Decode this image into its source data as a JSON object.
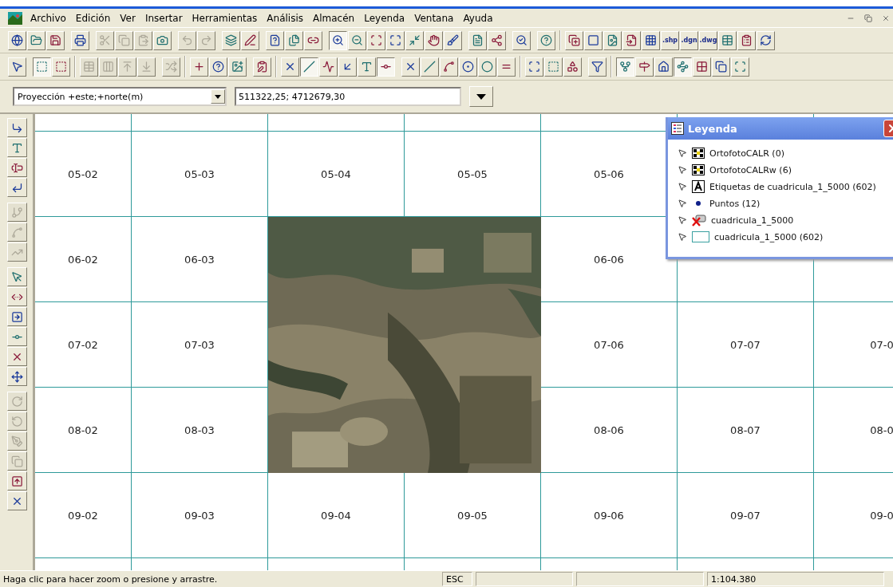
{
  "menu": [
    "Archivo",
    "Edición",
    "Ver",
    "Insertar",
    "Herramientas",
    "Análisis",
    "Almacén",
    "Leyenda",
    "Ventana",
    "Ayuda"
  ],
  "toolbar_1": [
    {
      "disabled": false,
      "pressed": false
    },
    {
      "disabled": false,
      "pressed": false
    },
    {
      "disabled": false,
      "pressed": false
    },
    {
      "kind": "sep"
    },
    {
      "disabled": false,
      "pressed": false
    },
    {
      "kind": "sep"
    },
    {
      "disabled": true,
      "pressed": false
    },
    {
      "disabled": true,
      "pressed": false
    },
    {
      "disabled": true,
      "pressed": false
    },
    {
      "disabled": false,
      "pressed": false
    },
    {
      "kind": "sep"
    },
    {
      "disabled": true,
      "pressed": false
    },
    {
      "disabled": true,
      "pressed": false
    },
    {
      "kind": "sep"
    },
    {
      "disabled": false,
      "pressed": false
    },
    {
      "disabled": false,
      "pressed": false
    },
    {
      "kind": "sep"
    },
    {
      "disabled": false,
      "pressed": false
    },
    {
      "disabled": false,
      "pressed": false
    },
    {
      "disabled": false,
      "pressed": false
    },
    {
      "kind": "sep"
    },
    {
      "disabled": false,
      "pressed": true
    },
    {
      "disabled": false,
      "pressed": false
    },
    {
      "disabled": false,
      "pressed": false
    },
    {
      "disabled": false,
      "pressed": false
    },
    {
      "disabled": false,
      "pressed": false
    },
    {
      "disabled": false,
      "pressed": false
    },
    {
      "disabled": false,
      "pressed": false
    },
    {
      "kind": "sep"
    },
    {
      "disabled": false,
      "pressed": false
    },
    {
      "disabled": false,
      "pressed": false
    },
    {
      "kind": "sep"
    },
    {
      "disabled": false,
      "pressed": false
    },
    {
      "kind": "sep"
    },
    {
      "disabled": false,
      "pressed": false
    },
    {
      "kind": "bar"
    },
    {
      "disabled": false,
      "pressed": false
    },
    {
      "disabled": false,
      "pressed": false
    },
    {
      "disabled": false,
      "pressed": false
    },
    {
      "disabled": false,
      "pressed": false
    },
    {
      "disabled": false,
      "pressed": false
    },
    {
      "disabled": false,
      "pressed": false,
      "label": ".shp"
    },
    {
      "disabled": false,
      "pressed": false,
      "label": ".dgn"
    },
    {
      "disabled": false,
      "pressed": false,
      "label": ".dwg"
    },
    {
      "disabled": false,
      "pressed": false
    },
    {
      "disabled": false,
      "pressed": false
    },
    {
      "disabled": false,
      "pressed": false
    }
  ],
  "toolbar_2": [
    {
      "disabled": false,
      "pressed": false
    },
    {
      "kind": "sep"
    },
    {
      "disabled": false,
      "pressed": true
    },
    {
      "disabled": false,
      "pressed": false
    },
    {
      "kind": "bar"
    },
    {
      "disabled": true,
      "pressed": false
    },
    {
      "disabled": true,
      "pressed": false
    },
    {
      "disabled": true,
      "pressed": false
    },
    {
      "disabled": true,
      "pressed": false
    },
    {
      "kind": "sep"
    },
    {
      "disabled": true,
      "pressed": false
    },
    {
      "kind": "bar"
    },
    {
      "disabled": false,
      "pressed": false
    },
    {
      "disabled": false,
      "pressed": false
    },
    {
      "disabled": false,
      "pressed": false
    },
    {
      "kind": "sep"
    },
    {
      "disabled": false,
      "pressed": false
    },
    {
      "kind": "bar"
    },
    {
      "disabled": false,
      "pressed": false
    },
    {
      "disabled": false,
      "pressed": true
    },
    {
      "disabled": false,
      "pressed": false
    },
    {
      "disabled": false,
      "pressed": false
    },
    {
      "disabled": false,
      "pressed": false
    },
    {
      "disabled": false,
      "pressed": true
    },
    {
      "kind": "sep"
    },
    {
      "disabled": false,
      "pressed": false
    },
    {
      "disabled": false,
      "pressed": false
    },
    {
      "disabled": false,
      "pressed": false
    },
    {
      "disabled": false,
      "pressed": false
    },
    {
      "disabled": false,
      "pressed": false
    },
    {
      "disabled": false,
      "pressed": false
    },
    {
      "kind": "bar"
    },
    {
      "disabled": false,
      "pressed": false
    },
    {
      "disabled": false,
      "pressed": false
    },
    {
      "disabled": false,
      "pressed": false
    },
    {
      "kind": "sep"
    },
    {
      "disabled": false,
      "pressed": false
    },
    {
      "kind": "bar"
    },
    {
      "disabled": false,
      "pressed": true
    },
    {
      "disabled": false,
      "pressed": false
    },
    {
      "disabled": false,
      "pressed": false
    },
    {
      "disabled": false,
      "pressed": true
    },
    {
      "disabled": false,
      "pressed": false
    },
    {
      "disabled": false,
      "pressed": false
    },
    {
      "disabled": false,
      "pressed": false
    }
  ],
  "coordinates": {
    "projection": "Proyección +este;+norte(m)",
    "value": "511322,25; 4712679,30"
  },
  "side_toolbar": [
    {
      "disabled": false
    },
    {
      "disabled": false
    },
    {
      "disabled": false
    },
    {
      "disabled": false
    },
    {
      "kind": "sep"
    },
    {
      "disabled": true
    },
    {
      "disabled": true
    },
    {
      "disabled": true
    },
    {
      "kind": "sep"
    },
    {
      "disabled": false
    },
    {
      "disabled": false
    },
    {
      "disabled": false
    },
    {
      "disabled": false
    },
    {
      "disabled": false
    },
    {
      "disabled": false
    },
    {
      "kind": "sep"
    },
    {
      "disabled": true
    },
    {
      "disabled": true
    },
    {
      "disabled": true
    },
    {
      "disabled": true
    },
    {
      "disabled": false
    },
    {
      "disabled": false
    }
  ],
  "map": {
    "rows": [
      [
        {
          "kind": "blank"
        },
        {
          "kind": "blank"
        },
        {
          "kind": "blank"
        },
        {
          "kind": "blank"
        },
        {
          "kind": "blank"
        },
        {
          "kind": "blank"
        },
        {
          "kind": "hidden"
        }
      ],
      [
        {
          "label": "05-02"
        },
        {
          "label": "05-03"
        },
        {
          "label": "05-04"
        },
        {
          "label": "05-05"
        },
        {
          "label": "05-06"
        },
        {
          "kind": "hidden"
        },
        {
          "kind": "hidden"
        }
      ],
      [
        {
          "label": "06-02"
        },
        {
          "label": "06-03"
        },
        {
          "kind": "covered"
        },
        {
          "kind": "covered"
        },
        {
          "label": "06-06"
        },
        {
          "kind": "blank"
        },
        {
          "kind": "blank"
        }
      ],
      [
        {
          "label": "07-02"
        },
        {
          "label": "07-03"
        },
        {
          "kind": "covered"
        },
        {
          "kind": "covered"
        },
        {
          "label": "07-06"
        },
        {
          "label": "07-07"
        },
        {
          "label": "07-0"
        }
      ],
      [
        {
          "label": "08-02"
        },
        {
          "label": "08-03"
        },
        {
          "kind": "covered"
        },
        {
          "kind": "covered"
        },
        {
          "label": "08-06"
        },
        {
          "label": "08-07"
        },
        {
          "label": "08-0"
        }
      ],
      [
        {
          "label": "09-02"
        },
        {
          "label": "09-03"
        },
        {
          "label": "09-04"
        },
        {
          "label": "09-05"
        },
        {
          "label": "09-06"
        },
        {
          "label": "09-07"
        },
        {
          "label": "09-0"
        }
      ],
      [
        {
          "kind": "blank"
        },
        {
          "kind": "blank"
        },
        {
          "kind": "blank"
        },
        {
          "kind": "blank"
        },
        {
          "kind": "blank"
        },
        {
          "kind": "blank"
        },
        {
          "kind": "blank"
        }
      ]
    ]
  },
  "legend": {
    "title": "Leyenda",
    "layers": [
      {
        "kind": "raster",
        "name": "OrtofotoCALR  (0)"
      },
      {
        "kind": "raster",
        "name": "OrtofotoCALRw  (6)"
      },
      {
        "kind": "text",
        "name": "Etiquetas de cuadricula_1_5000  (602)"
      },
      {
        "kind": "point",
        "name": "Puntos  (12)"
      },
      {
        "kind": "removed",
        "name": "cuadricula_1_5000"
      },
      {
        "kind": "polygon",
        "name": "cuadricula_1_5000  (602)"
      }
    ]
  },
  "status_bar": {
    "message": "Haga clic para hacer zoom o presione y arrastre.",
    "key": "ESC",
    "scale": "1:104.380"
  }
}
